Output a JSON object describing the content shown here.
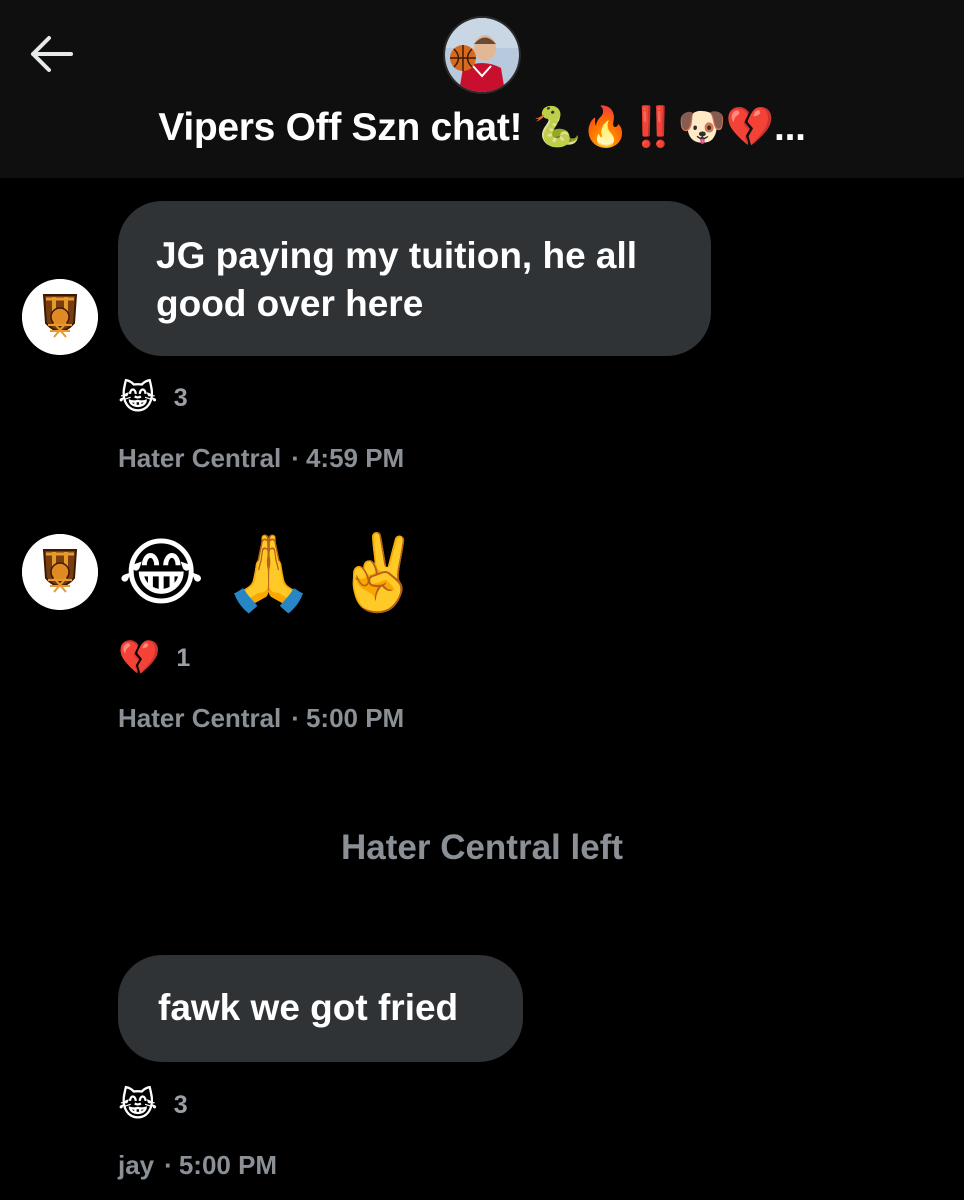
{
  "header": {
    "back_icon": "arrow-left-icon",
    "title": "Vipers Off Szn chat! 🐍🔥‼️🐶💔...",
    "avatar_icon": "group-avatar-basketball-player"
  },
  "messages": [
    {
      "text": "JG paying my tuition, he all\ngood over here",
      "reaction": {
        "emoji": "😹",
        "count": "3"
      },
      "sender": "Hater Central",
      "time": "4:59 PM"
    },
    {
      "text": "😂🙏✌️",
      "reaction": {
        "emoji": "💔",
        "count": "1"
      },
      "sender": "Hater Central",
      "time": "5:00 PM"
    },
    {
      "text": "fawk we got fried",
      "reaction": {
        "emoji": "😹",
        "count": "3"
      },
      "sender": "jay",
      "time": "5:00 PM"
    }
  ],
  "system": {
    "left_notice": "Hater Central left"
  },
  "colors": {
    "background": "#000000",
    "header_bg": "#0f0f0f",
    "bubble_bg": "#2f3336",
    "muted_text": "#8b9096"
  }
}
